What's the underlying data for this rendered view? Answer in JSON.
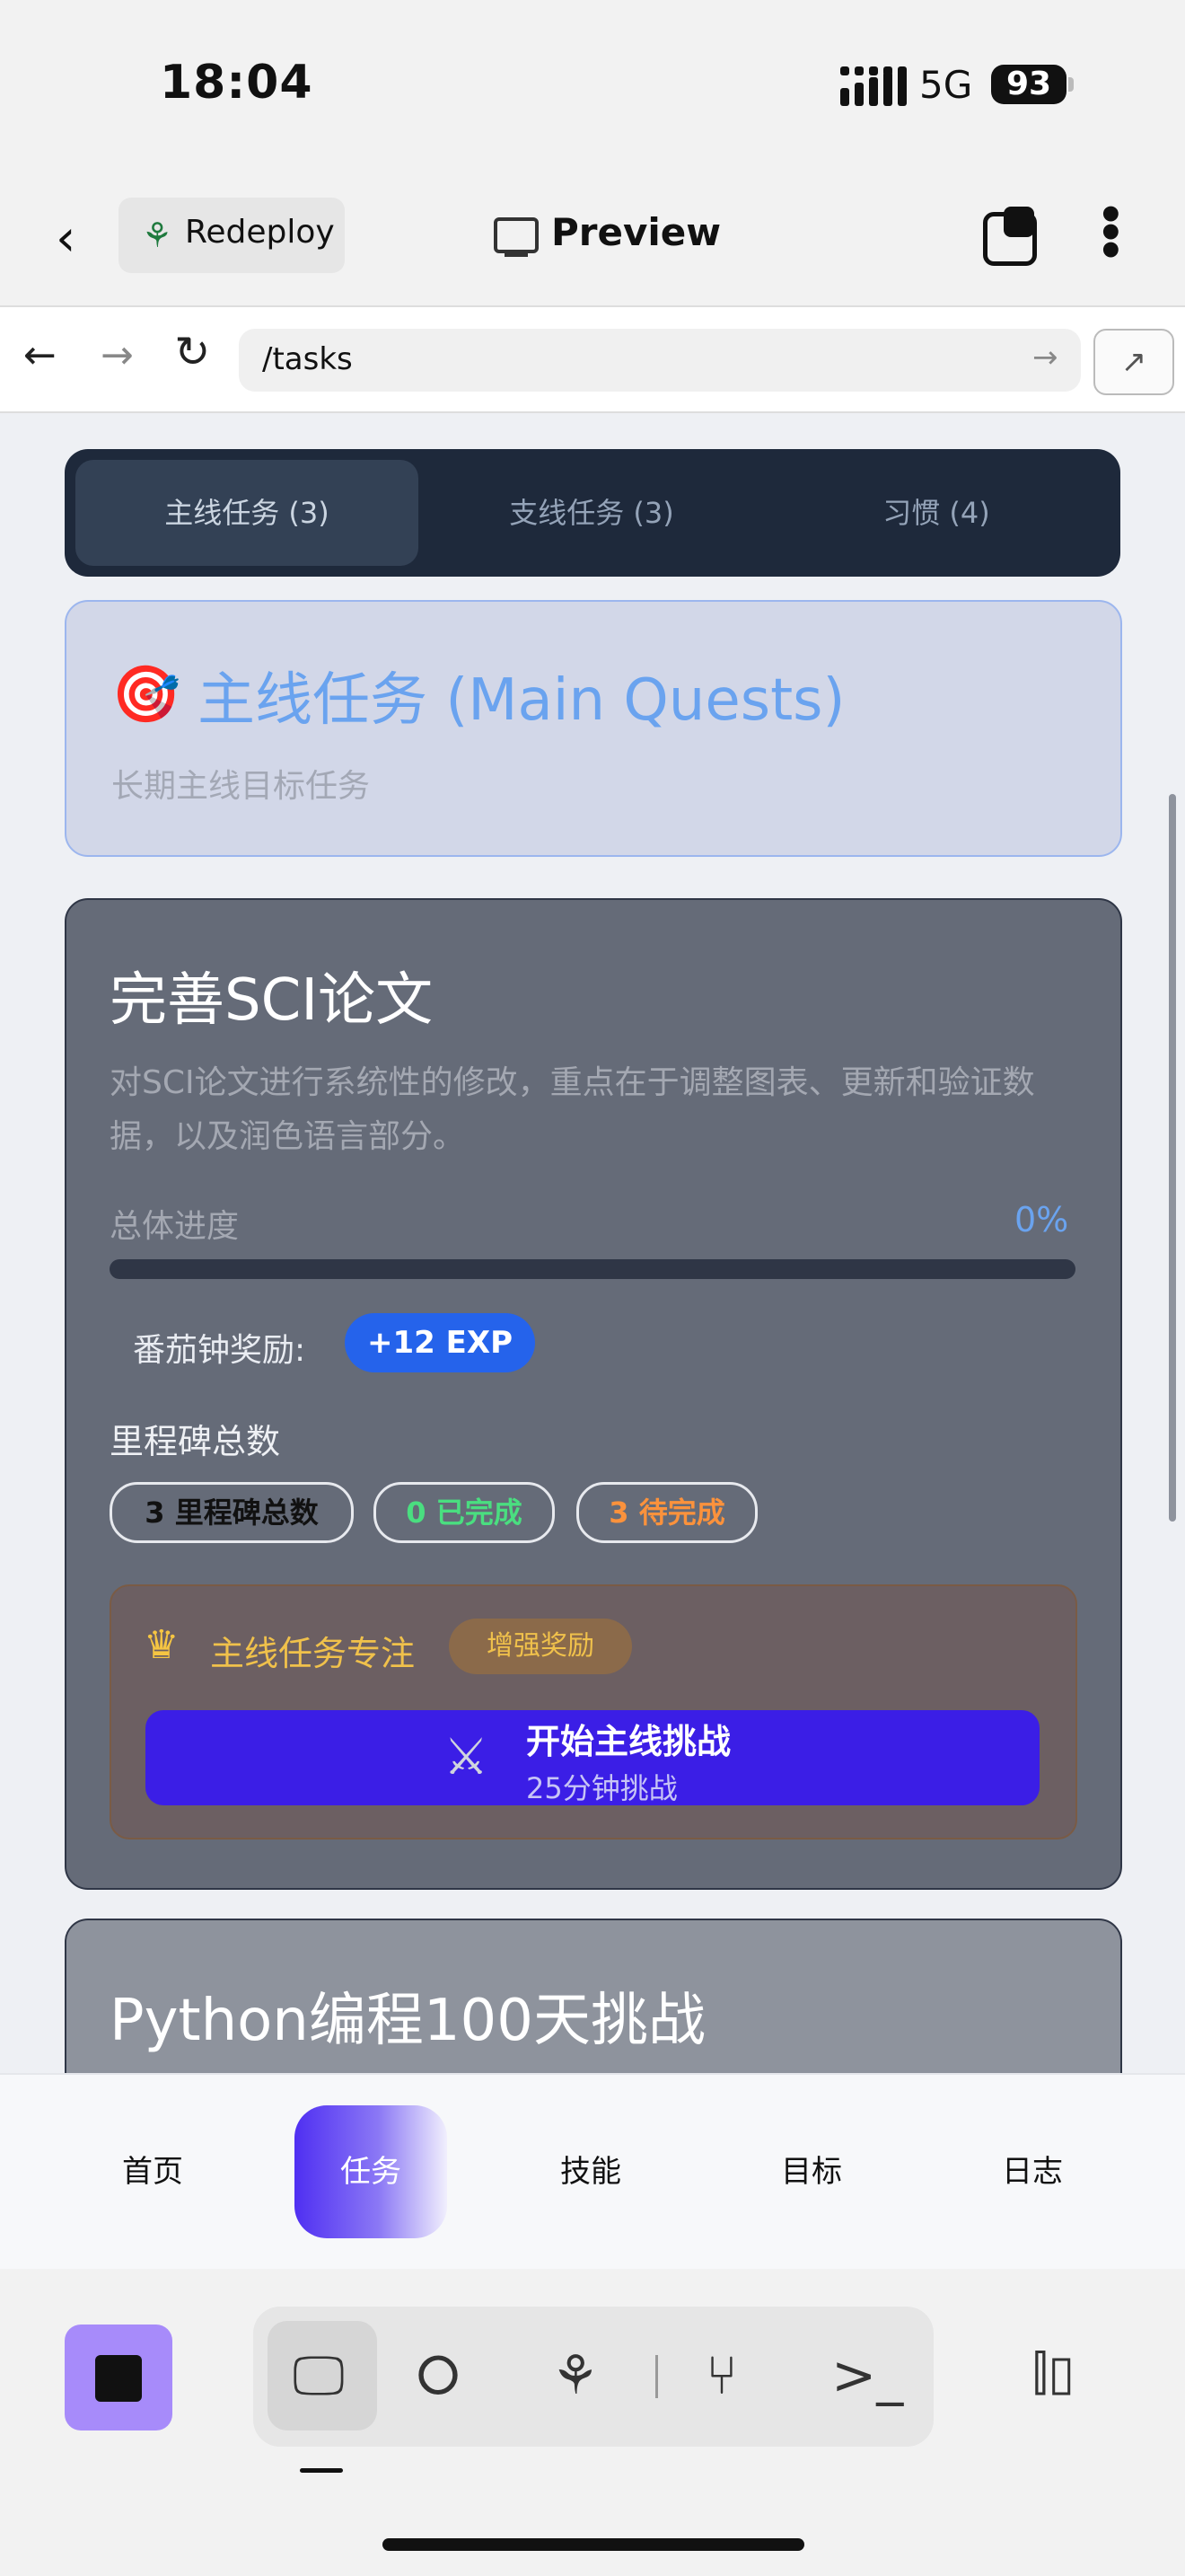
{
  "status_bar": {
    "time": "18:04",
    "network": "5G",
    "battery": "93"
  },
  "top_nav": {
    "redeploy_label": "Redeploy",
    "preview_label": "Preview"
  },
  "browser": {
    "url": "/tasks"
  },
  "segmented_tabs": [
    {
      "label": "主线任务 (3)",
      "active": true
    },
    {
      "label": "支线任务 (3)",
      "active": false
    },
    {
      "label": "习惯 (4)",
      "active": false
    }
  ],
  "section_header": {
    "icon": "🎯",
    "title": "主线任务 (Main Quests)",
    "subtitle": "长期主线目标任务"
  },
  "task_card": {
    "title": "完善SCI论文",
    "description": "对SCI论文进行系统性的修改，重点在于调整图表、更新和验证数据，以及润色语言部分。",
    "progress_label": "总体进度",
    "progress_value": "0%",
    "progress_fraction": 0,
    "tomato_label": "番茄钟奖励:",
    "exp_badge": "+12 EXP",
    "milestone_title": "里程碑总数",
    "pills": {
      "total": "3 里程碑总数",
      "done": "0 已完成",
      "pending": "3 待完成"
    },
    "focus": {
      "title": "主线任务专注",
      "badge": "增强奖励",
      "button_label": "开始主线挑战",
      "button_sub": "25分钟挑战"
    }
  },
  "task_card_2": {
    "title": "Python编程100天挑战"
  },
  "app_nav": {
    "items": [
      "首页",
      "任务",
      "技能",
      "目标",
      "日志"
    ],
    "active_index": 1
  },
  "colors": {
    "accent": "#6aa3ef",
    "exp_badge": "#2563eb",
    "start_button": "#3b1ee6",
    "done": "#4ade80",
    "pending": "#fb923c"
  }
}
